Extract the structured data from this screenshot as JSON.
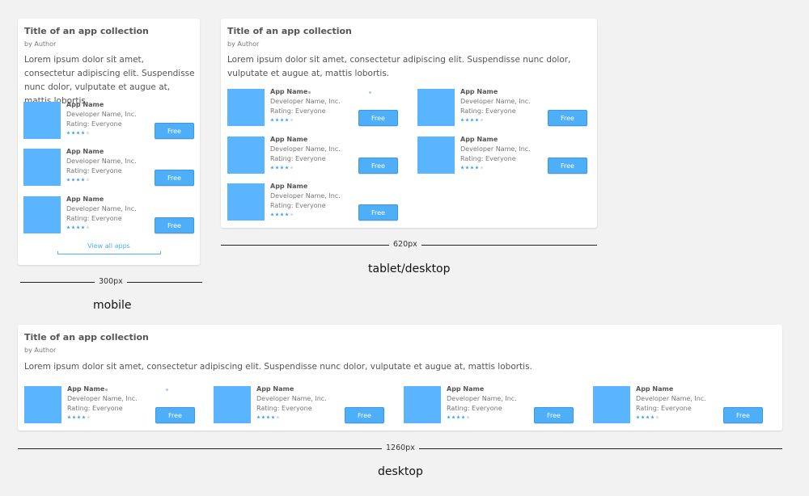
{
  "collection": {
    "title": "Title of an app collection",
    "author": "by Author",
    "description": "Lorem ipsum dolor sit amet, consectetur adipiscing elit. Suspendisse nunc dolor, vulputate et augue at, mattis lobortis."
  },
  "app": {
    "name": "App Name",
    "developer": "Developer Name, Inc.",
    "rating_text": "Rating: Everyone",
    "stars_filled": 4,
    "stars_total": 5,
    "button_label": "Free"
  },
  "mobile": {
    "view_all_label": "View all apps",
    "width_label": "300px",
    "caption": "mobile"
  },
  "tablet": {
    "width_label": "620px",
    "caption": "tablet/desktop"
  },
  "desktop": {
    "width_label": "1260px",
    "caption": "desktop"
  },
  "colors": {
    "thumbnail": "#5ab4ff",
    "accent": "#4eaef8",
    "star": "#4a9fe8",
    "background": "#f2f2f2"
  },
  "icons": {
    "star": "star-icon"
  }
}
